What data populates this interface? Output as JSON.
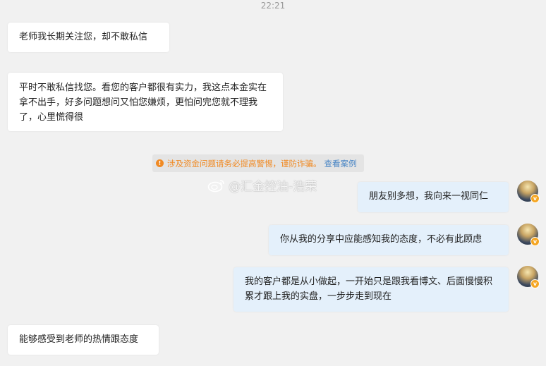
{
  "chat": {
    "timestamp": "22:21",
    "messages": [
      {
        "side": "left",
        "text": "老师我长期关注您，却不敢私信"
      },
      {
        "side": "left",
        "text": "平时不敢私信找您。看您的客户都很有实力，我这点本金实在拿不出手，好多问题想问又怕您嫌烦，更怕问完您就不理我了，心里慌得很"
      },
      {
        "side": "right",
        "text": "朋友别多想，我向来一视同仁"
      },
      {
        "side": "right",
        "text": "你从我的分享中应能感知我的态度，不必有此顾虑"
      },
      {
        "side": "right",
        "text": "我的客户都是从小做起，一开始只是跟我看博文、后面慢慢积累才跟上我的实盘，一步步走到现在"
      },
      {
        "side": "left",
        "text": "能够感受到老师的热情跟态度"
      }
    ],
    "notice": {
      "icon": "warning-icon",
      "text": "涉及资金问题请务必提高警惕，谨防诈骗。",
      "link": "查看案例",
      "color": "#f08a24",
      "link_color": "#4a86c5"
    },
    "watermark": {
      "icon": "weibo-icon",
      "text": "@汇金控油-浩荣"
    },
    "colors": {
      "background": "#f1f1f1",
      "left_bubble": "#ffffff",
      "right_bubble": "#e4f0fb"
    }
  }
}
